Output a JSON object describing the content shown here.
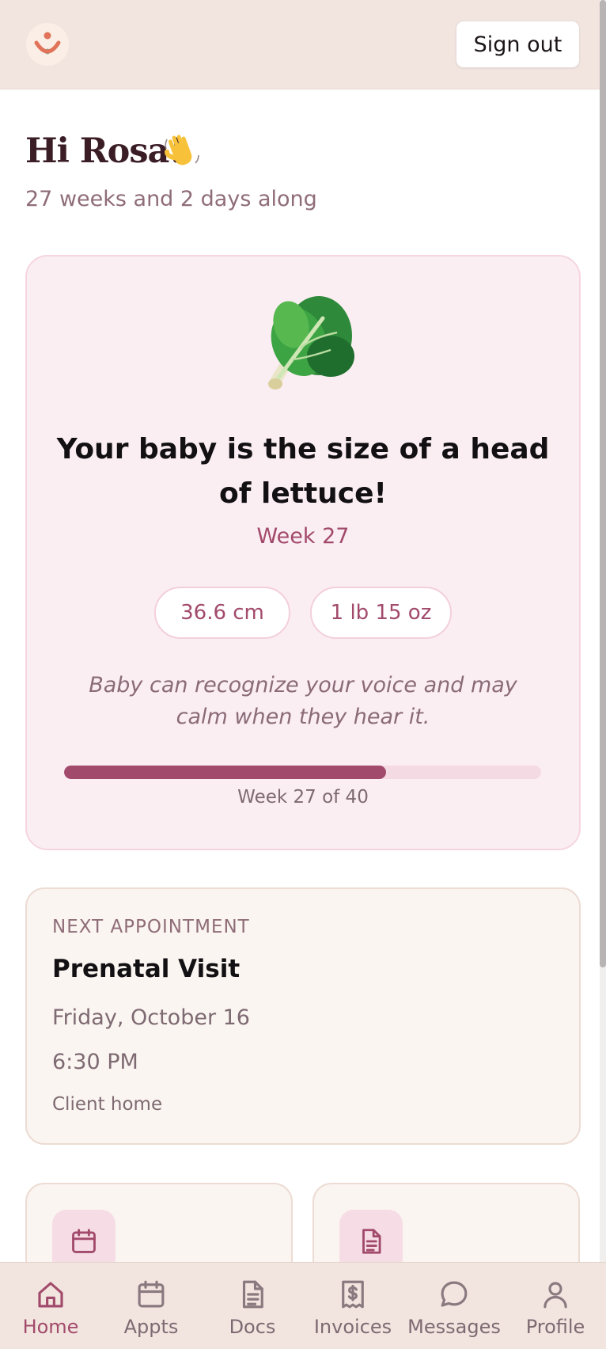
{
  "header": {
    "logo": "app-logo",
    "sign_out_label": "Sign out"
  },
  "greeting": {
    "title": "Hi Rosa!",
    "emoji": "waving-hand-icon",
    "subtitle": "27 weeks and 2 days along"
  },
  "baby_size": {
    "image": "lettuce-icon",
    "headline": "Your baby is the size of a head of lettuce!",
    "week_label": "Week 27",
    "length": "36.6 cm",
    "weight": "1 lb 15 oz",
    "fact": "Baby can recognize your voice and may calm when they hear it.",
    "progress_fraction": 0.675,
    "progress_label": "Week 27 of 40"
  },
  "next_appointment": {
    "kicker": "NEXT APPOINTMENT",
    "title": "Prenatal Visit",
    "date": "Friday, October 16",
    "time": "6:30 PM",
    "location": "Client home"
  },
  "quick_cards": [
    {
      "icon": "calendar-icon"
    },
    {
      "icon": "document-icon"
    }
  ],
  "nav": [
    {
      "label": "Home",
      "icon": "home-icon",
      "active": true
    },
    {
      "label": "Appts",
      "icon": "calendar-icon",
      "active": false
    },
    {
      "label": "Docs",
      "icon": "document-icon",
      "active": false
    },
    {
      "label": "Invoices",
      "icon": "receipt-icon",
      "active": false
    },
    {
      "label": "Messages",
      "icon": "chat-icon",
      "active": false
    },
    {
      "label": "Profile",
      "icon": "person-icon",
      "active": false
    }
  ],
  "colors": {
    "accent": "#a24a6b",
    "header_bg": "#f2e5e0",
    "baby_card_bg": "#fbeef2",
    "appt_card_bg": "#fbf5f2"
  }
}
